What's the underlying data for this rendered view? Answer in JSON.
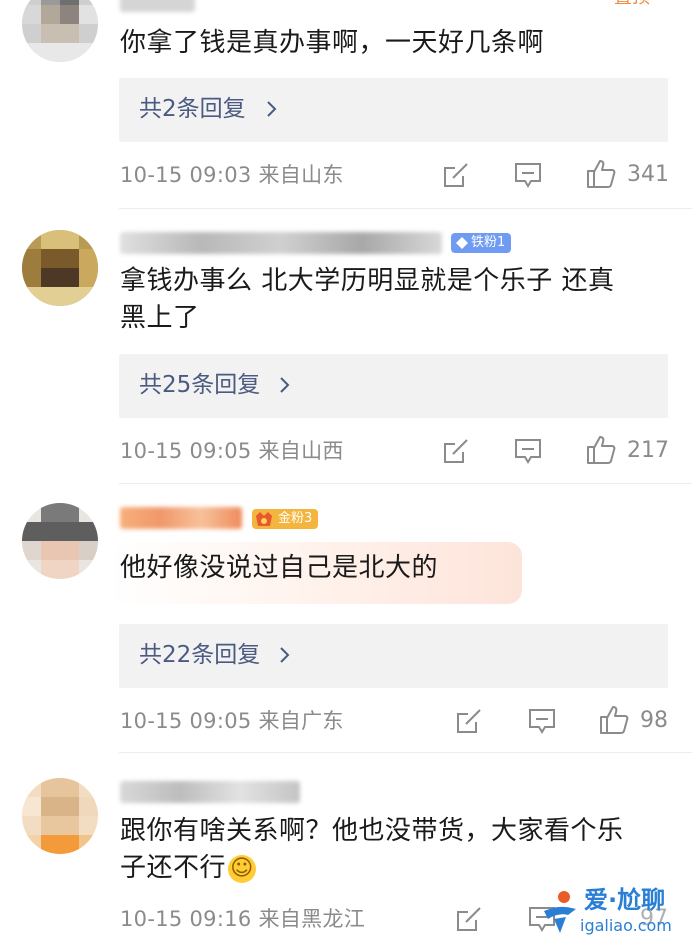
{
  "comments": [
    {
      "text": "你拿了钱是真办事啊，一天好几条啊",
      "badge": "",
      "reply_label": "共2条回复",
      "time": "10-15 09:03",
      "location": "来自山东",
      "likes": "341",
      "top_tag": "置顶"
    },
    {
      "text_line1": "拿钱办事么 北大学历明显就是个乐子 还真",
      "text_line2": "黑上了",
      "badge": "铁粉1",
      "reply_label": "共25条回复",
      "time": "10-15 09:05",
      "location": "来自山西",
      "likes": "217"
    },
    {
      "text": "他好像没说过自己是北大的",
      "badge": "金粉3",
      "reply_label": "共22条回复",
      "time": "10-15 09:05",
      "location": "来自广东",
      "likes": "98"
    },
    {
      "text_line1": "跟你有啥关系啊？他也没带货，大家看个乐",
      "text_line2": "子还不行",
      "emoji": "☺",
      "time": "10-15 09:16",
      "location": "来自黑龙江",
      "likes": "97"
    }
  ],
  "watermark": {
    "top": "爱·尬聊",
    "bottom": "igaliao.com"
  },
  "colors": {
    "reply_text": "#4b5a80",
    "meta": "#8b8b8b",
    "reply_bg": "#f2f2f2",
    "badge_blue": "#6f9cf2",
    "badge_gold": "#f4b53f"
  },
  "icons": [
    "edit-icon",
    "comment-icon",
    "thumbs-up-icon",
    "chevron-right-icon"
  ]
}
